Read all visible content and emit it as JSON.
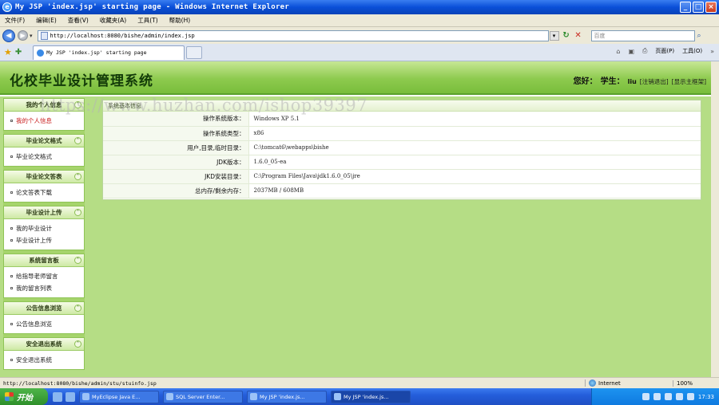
{
  "window": {
    "title": "My JSP 'index.jsp' starting page - Windows Internet Explorer",
    "buttons": {
      "minimize": "_",
      "maximize": "□",
      "close": "×"
    }
  },
  "menubar": [
    "文件(F)",
    "编辑(E)",
    "查看(V)",
    "收藏夹(A)",
    "工具(T)",
    "帮助(H)"
  ],
  "address": {
    "url": "http://localhost:8080/bishe/admin/index.jsp",
    "search_placeholder": "百度"
  },
  "tab": {
    "label": "My JSP 'index.jsp' starting page"
  },
  "command_bar": {
    "page": "页面(P)",
    "tools": "工具(O)"
  },
  "site": {
    "title": "化校毕业设计管理系统",
    "greeting": "您好：",
    "role": "学生：",
    "username": "liu",
    "logout": "[注销退出]",
    "home": "[显示主框架]"
  },
  "watermark": "https://www.huzhan.com/ishop39397",
  "sidebar": [
    {
      "title": "我的个人信息",
      "items": [
        "我的个人信息"
      ],
      "active": 0
    },
    {
      "title": "毕业论文格式",
      "items": [
        "毕业论文格式"
      ]
    },
    {
      "title": "毕业论文答表",
      "items": [
        "论文答表下载"
      ]
    },
    {
      "title": "毕业设计上传",
      "items": [
        "我的毕业设计",
        "毕业设计上传"
      ]
    },
    {
      "title": "系统留言板",
      "items": [
        "给指导老师留言",
        "我的留言列表"
      ]
    },
    {
      "title": "公告信息浏览",
      "items": [
        "公告信息浏览"
      ]
    },
    {
      "title": "安全退出系统",
      "items": [
        "安全退出系统"
      ]
    }
  ],
  "panel": {
    "title": "系统基本信息",
    "rows": [
      {
        "key": "操作系统版本：",
        "value": "Windows XP  5.1"
      },
      {
        "key": "操作系统类型：",
        "value": "x86"
      },
      {
        "key": "用户,目录,临时目录：",
        "value": "C:\\tomcat6\\webapps\\bishe"
      },
      {
        "key": "JDK版本：",
        "value": "1.6.0_05-ea"
      },
      {
        "key": "JKD安装目录：",
        "value": "C:\\Program Files\\Java\\jdk1.6.0_05\\jre"
      },
      {
        "key": "总内存/剩余内存：",
        "value": "2037MB  /  608MB"
      }
    ]
  },
  "statusbar": {
    "text": "http://localhost:8080/bishe/admin/stu/stuinfo.jsp",
    "zone": "Internet",
    "zoom": "100%"
  },
  "taskbar": {
    "start": "开始",
    "tasks": [
      {
        "label": "MyEclipse Java E...",
        "active": false
      },
      {
        "label": "SQL Server Enter...",
        "active": false
      },
      {
        "label": "My JSP 'index.js...",
        "active": false
      },
      {
        "label": "My JSP 'index.js...",
        "active": true
      }
    ],
    "clock": "17:33"
  }
}
